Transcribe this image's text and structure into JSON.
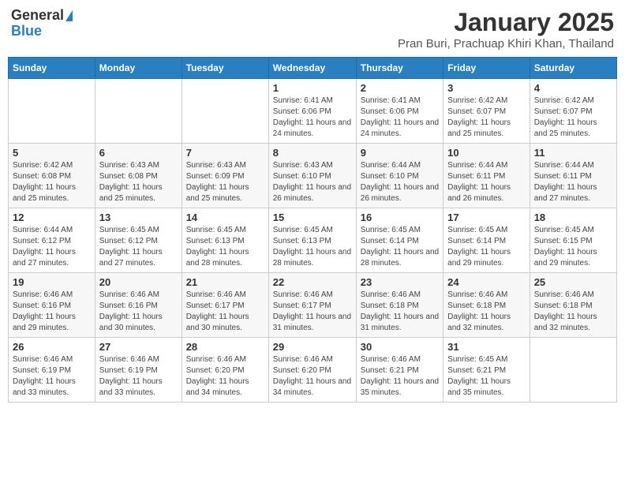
{
  "logo": {
    "general": "General",
    "blue": "Blue"
  },
  "title": "January 2025",
  "subtitle": "Pran Buri, Prachuap Khiri Khan, Thailand",
  "days_header": [
    "Sunday",
    "Monday",
    "Tuesday",
    "Wednesday",
    "Thursday",
    "Friday",
    "Saturday"
  ],
  "weeks": [
    [
      {
        "num": "",
        "detail": ""
      },
      {
        "num": "",
        "detail": ""
      },
      {
        "num": "",
        "detail": ""
      },
      {
        "num": "1",
        "detail": "Sunrise: 6:41 AM\nSunset: 6:06 PM\nDaylight: 11 hours and 24 minutes."
      },
      {
        "num": "2",
        "detail": "Sunrise: 6:41 AM\nSunset: 6:06 PM\nDaylight: 11 hours and 24 minutes."
      },
      {
        "num": "3",
        "detail": "Sunrise: 6:42 AM\nSunset: 6:07 PM\nDaylight: 11 hours and 25 minutes."
      },
      {
        "num": "4",
        "detail": "Sunrise: 6:42 AM\nSunset: 6:07 PM\nDaylight: 11 hours and 25 minutes."
      }
    ],
    [
      {
        "num": "5",
        "detail": "Sunrise: 6:42 AM\nSunset: 6:08 PM\nDaylight: 11 hours and 25 minutes."
      },
      {
        "num": "6",
        "detail": "Sunrise: 6:43 AM\nSunset: 6:08 PM\nDaylight: 11 hours and 25 minutes."
      },
      {
        "num": "7",
        "detail": "Sunrise: 6:43 AM\nSunset: 6:09 PM\nDaylight: 11 hours and 25 minutes."
      },
      {
        "num": "8",
        "detail": "Sunrise: 6:43 AM\nSunset: 6:10 PM\nDaylight: 11 hours and 26 minutes."
      },
      {
        "num": "9",
        "detail": "Sunrise: 6:44 AM\nSunset: 6:10 PM\nDaylight: 11 hours and 26 minutes."
      },
      {
        "num": "10",
        "detail": "Sunrise: 6:44 AM\nSunset: 6:11 PM\nDaylight: 11 hours and 26 minutes."
      },
      {
        "num": "11",
        "detail": "Sunrise: 6:44 AM\nSunset: 6:11 PM\nDaylight: 11 hours and 27 minutes."
      }
    ],
    [
      {
        "num": "12",
        "detail": "Sunrise: 6:44 AM\nSunset: 6:12 PM\nDaylight: 11 hours and 27 minutes."
      },
      {
        "num": "13",
        "detail": "Sunrise: 6:45 AM\nSunset: 6:12 PM\nDaylight: 11 hours and 27 minutes."
      },
      {
        "num": "14",
        "detail": "Sunrise: 6:45 AM\nSunset: 6:13 PM\nDaylight: 11 hours and 28 minutes."
      },
      {
        "num": "15",
        "detail": "Sunrise: 6:45 AM\nSunset: 6:13 PM\nDaylight: 11 hours and 28 minutes."
      },
      {
        "num": "16",
        "detail": "Sunrise: 6:45 AM\nSunset: 6:14 PM\nDaylight: 11 hours and 28 minutes."
      },
      {
        "num": "17",
        "detail": "Sunrise: 6:45 AM\nSunset: 6:14 PM\nDaylight: 11 hours and 29 minutes."
      },
      {
        "num": "18",
        "detail": "Sunrise: 6:45 AM\nSunset: 6:15 PM\nDaylight: 11 hours and 29 minutes."
      }
    ],
    [
      {
        "num": "19",
        "detail": "Sunrise: 6:46 AM\nSunset: 6:16 PM\nDaylight: 11 hours and 29 minutes."
      },
      {
        "num": "20",
        "detail": "Sunrise: 6:46 AM\nSunset: 6:16 PM\nDaylight: 11 hours and 30 minutes."
      },
      {
        "num": "21",
        "detail": "Sunrise: 6:46 AM\nSunset: 6:17 PM\nDaylight: 11 hours and 30 minutes."
      },
      {
        "num": "22",
        "detail": "Sunrise: 6:46 AM\nSunset: 6:17 PM\nDaylight: 11 hours and 31 minutes."
      },
      {
        "num": "23",
        "detail": "Sunrise: 6:46 AM\nSunset: 6:18 PM\nDaylight: 11 hours and 31 minutes."
      },
      {
        "num": "24",
        "detail": "Sunrise: 6:46 AM\nSunset: 6:18 PM\nDaylight: 11 hours and 32 minutes."
      },
      {
        "num": "25",
        "detail": "Sunrise: 6:46 AM\nSunset: 6:18 PM\nDaylight: 11 hours and 32 minutes."
      }
    ],
    [
      {
        "num": "26",
        "detail": "Sunrise: 6:46 AM\nSunset: 6:19 PM\nDaylight: 11 hours and 33 minutes."
      },
      {
        "num": "27",
        "detail": "Sunrise: 6:46 AM\nSunset: 6:19 PM\nDaylight: 11 hours and 33 minutes."
      },
      {
        "num": "28",
        "detail": "Sunrise: 6:46 AM\nSunset: 6:20 PM\nDaylight: 11 hours and 34 minutes."
      },
      {
        "num": "29",
        "detail": "Sunrise: 6:46 AM\nSunset: 6:20 PM\nDaylight: 11 hours and 34 minutes."
      },
      {
        "num": "30",
        "detail": "Sunrise: 6:46 AM\nSunset: 6:21 PM\nDaylight: 11 hours and 35 minutes."
      },
      {
        "num": "31",
        "detail": "Sunrise: 6:45 AM\nSunset: 6:21 PM\nDaylight: 11 hours and 35 minutes."
      },
      {
        "num": "",
        "detail": ""
      }
    ]
  ]
}
